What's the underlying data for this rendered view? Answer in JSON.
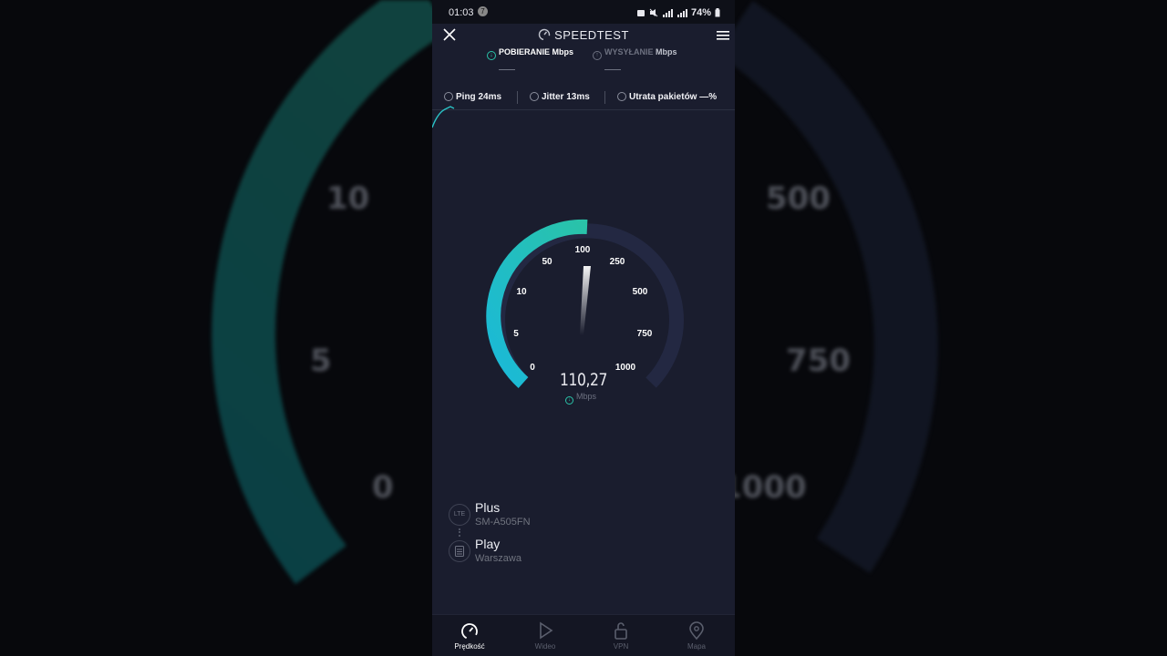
{
  "status_bar": {
    "time": "01:03",
    "notif_badge": "7",
    "battery": "74%"
  },
  "header": {
    "title": "SPEEDTEST"
  },
  "tests": {
    "download_label": "POBIERANIE",
    "download_unit": "Mbps",
    "upload_label": "WYSYŁANIE",
    "upload_unit": "Mbps"
  },
  "metrics": {
    "ping_label": "Ping",
    "ping_value": "24ms",
    "jitter_label": "Jitter",
    "jitter_value": "13ms",
    "loss_label": "Utrata pakietów",
    "loss_value": "—%"
  },
  "gauge": {
    "reading": "110,27",
    "unit": "Mbps",
    "current_value": 110.27,
    "scale_labels": [
      "0",
      "5",
      "10",
      "50",
      "100",
      "250",
      "500",
      "750",
      "1000"
    ],
    "colors": {
      "active_start": "#1ab9d9",
      "active_end": "#2ac3a8",
      "track": "#232842"
    }
  },
  "background_scale": [
    "10",
    "5",
    "0",
    "500",
    "750",
    "1000"
  ],
  "provider": {
    "name": "Plus",
    "device": "SM-A505FN",
    "icon_label": "LTE"
  },
  "server": {
    "name": "Play",
    "location": "Warszawa"
  },
  "nav": [
    {
      "label": "Prędkość",
      "icon": "speed-gauge-icon",
      "active": true
    },
    {
      "label": "Wideo",
      "icon": "play-icon",
      "active": false
    },
    {
      "label": "VPN",
      "icon": "lock-icon",
      "active": false
    },
    {
      "label": "Mapa",
      "icon": "map-pin-icon",
      "active": false
    }
  ]
}
